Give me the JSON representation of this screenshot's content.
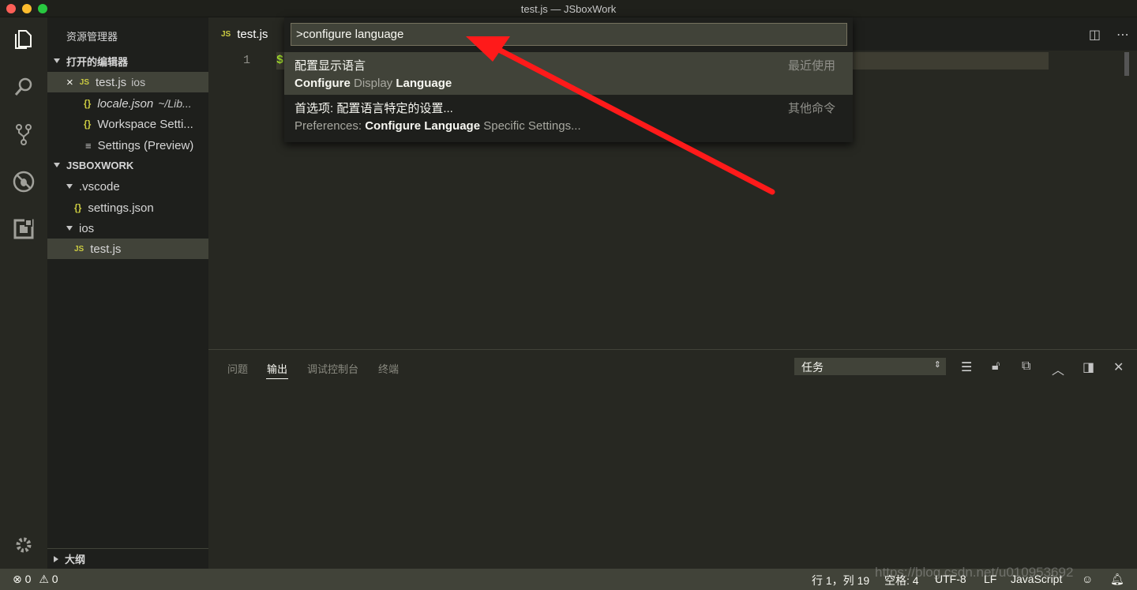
{
  "window": {
    "title": "test.js — JSboxWork"
  },
  "activity_bar": {
    "items": [
      "files-icon",
      "search-icon",
      "source-control-icon",
      "debug-icon",
      "extensions-icon"
    ],
    "settings_icon": "gear-icon"
  },
  "sidebar": {
    "title": "资源管理器",
    "open_editors": {
      "header": "打开的编辑器",
      "items": [
        {
          "close": "×",
          "type": "JS",
          "name": "test.js",
          "folder": "ios"
        },
        {
          "type": "{}",
          "name": "locale.json",
          "folder": "~/Lib..."
        },
        {
          "type": "{}",
          "name": "Workspace Setti...",
          "folder": ""
        },
        {
          "type": "≡",
          "name": "Settings (Preview)",
          "folder": ""
        }
      ]
    },
    "workspace": {
      "header": "JSBOXWORK",
      "items": [
        {
          "type": "folder",
          "name": ".vscode"
        },
        {
          "type": "{}",
          "name": "settings.json"
        },
        {
          "type": "folder",
          "name": "ios"
        },
        {
          "type": "JS",
          "name": "test.js"
        }
      ]
    },
    "outline": "大纲"
  },
  "editor": {
    "tab": {
      "type": "JS",
      "label": "test.js"
    },
    "line_number": "1",
    "code": "$"
  },
  "command_palette": {
    "input_value": ">configure language",
    "items": [
      {
        "label": "配置显示语言",
        "detail_bold1": "Configure",
        "detail_mid": " Display ",
        "detail_bold2": "Language",
        "detail_prefix": "",
        "detail_suffix": "",
        "right": "最近使用"
      },
      {
        "label": "首选项: 配置语言特定的设置...",
        "detail_prefix": "Preferences: ",
        "detail_bold1": "Configure Language",
        "detail_mid": " Specific Settings...",
        "detail_bold2": "",
        "detail_suffix": "",
        "right": "其他命令"
      }
    ]
  },
  "panel": {
    "tabs": [
      "问题",
      "输出",
      "调试控制台",
      "终端"
    ],
    "active_tab": "输出",
    "select_value": "任务"
  },
  "status_bar": {
    "errors": "0",
    "warnings": "0",
    "position": "行 1，列 19",
    "spaces": "空格: 4",
    "encoding": "UTF-8",
    "eol": "LF",
    "language": "JavaScript",
    "watermark": "https://blog.csdn.net/u010953692"
  },
  "colors": {
    "background": "#272822",
    "sidebar": "#1e1f1c",
    "accent": "#a6e22e",
    "arrow": "#ff1a1a"
  }
}
